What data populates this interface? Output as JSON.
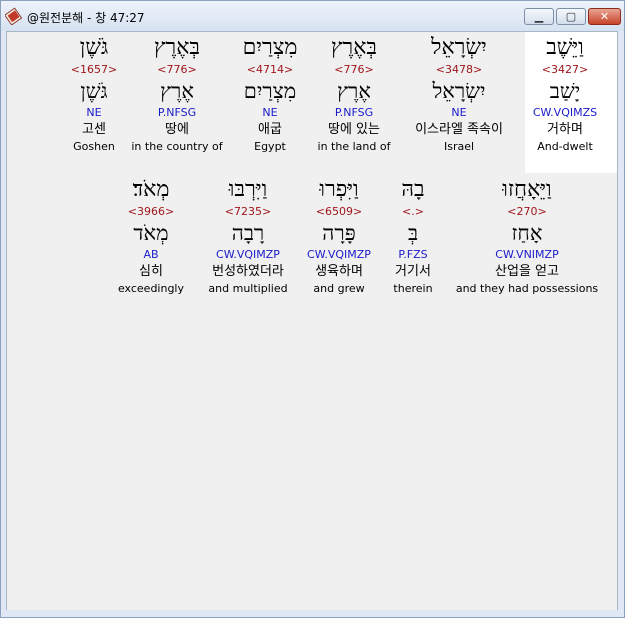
{
  "window": {
    "title": "@원전분해 - 창 47:27",
    "icon": "app-book-icon",
    "controls": {
      "minimize": "minimize-icon",
      "maximize": "maximize-icon",
      "close": "close-icon"
    }
  },
  "colors": {
    "strong": "#a0161a",
    "parse": "#1a1acb",
    "highlight": "#ffffff",
    "background": "#f0f0f0"
  },
  "rows": [
    {
      "words": [
        {
          "hebrew": "וַיֵּשֶׁב",
          "strong": "<3427>",
          "lemma": "יָשַׁב",
          "parse": "CW.VQIMZS",
          "korean": "거하며",
          "english": "And-dwelt",
          "selected": true
        },
        {
          "hebrew": "יִשְׂרָאֵל",
          "strong": "<3478>",
          "lemma": "יִשְׂרָאֵל",
          "parse": "NE",
          "korean": "이스라엘 족속이",
          "english": "Israel"
        },
        {
          "hebrew": "בְּאֶרֶץ",
          "strong": "<776>",
          "lemma": "אֶרֶץ",
          "parse": "P.NFSG",
          "korean": "땅에 있는",
          "english": "in the land of"
        },
        {
          "hebrew": "מִצְרַיִם",
          "strong": "<4714>",
          "lemma": "מִצְרַיִם",
          "parse": "NE",
          "korean": "애굽",
          "english": "Egypt"
        },
        {
          "hebrew": "בְּאֶרֶץ",
          "strong": "<776>",
          "lemma": "אֶרֶץ",
          "parse": "P.NFSG",
          "korean": "땅에",
          "english": "in the country of"
        },
        {
          "hebrew": "גֹּשֶׁן",
          "strong": "<1657>",
          "lemma": "גֹּשֶׁן",
          "parse": "NE",
          "korean": "고센",
          "english": "Goshen"
        }
      ]
    },
    {
      "words": [
        {
          "hebrew": "וַיֵּאָחֲזוּ",
          "strong": "<270>",
          "lemma": "אָחַז",
          "parse": "CW.VNIMZP",
          "korean": "산업을 얻고",
          "english": "and they had possessions"
        },
        {
          "hebrew": "בָהּ",
          "strong": "<.>",
          "lemma": "בְּ",
          "parse": "P.FZS",
          "korean": "거기서",
          "english": "therein"
        },
        {
          "hebrew": "וַיִּפְרוּ",
          "strong": "<6509>",
          "lemma": "פָּרָה",
          "parse": "CW.VQIMZP",
          "korean": "생육하며",
          "english": "and grew"
        },
        {
          "hebrew": "וַיִּרְבּוּ",
          "strong": "<7235>",
          "lemma": "רָבָה",
          "parse": "CW.VQIMZP",
          "korean": "번성하였더라",
          "english": "and multiplied"
        },
        {
          "hebrew": "מְאֹד׃",
          "strong": "<3966>",
          "lemma": "מְאֹד",
          "parse": "AB",
          "korean": "심히",
          "english": "exceedingly"
        }
      ]
    }
  ]
}
